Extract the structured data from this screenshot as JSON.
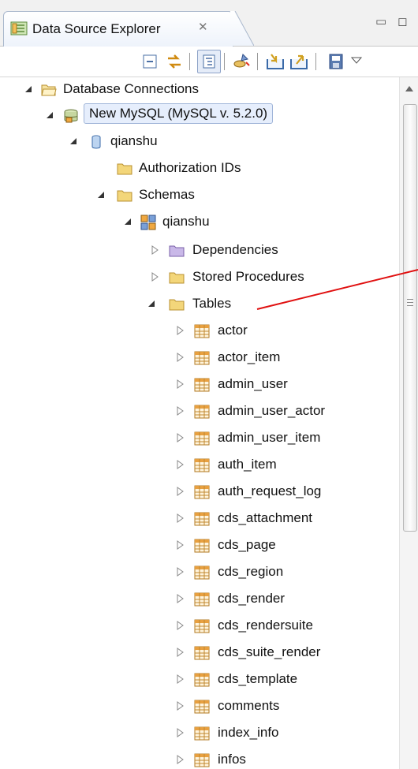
{
  "window": {
    "tab_title": "Data Source Explorer",
    "tab_close_glyph": "✕",
    "minimize_glyph": "▭",
    "maximize_glyph": "◻"
  },
  "toolbar": {
    "buttons": [
      {
        "name": "collapse-all-icon"
      },
      {
        "name": "link-with-editor-icon"
      },
      {
        "name": "show-tree-icon"
      },
      {
        "name": "new-connection-profile-icon"
      },
      {
        "name": "import-icon"
      },
      {
        "name": "export-icon"
      },
      {
        "name": "save-icon"
      },
      {
        "name": "view-menu-icon"
      }
    ]
  },
  "tree": {
    "root": "Database Connections",
    "connection": "New MySQL (MySQL v. 5.2.0)",
    "database": "qianshu",
    "authorization": "Authorization IDs",
    "schemas": "Schemas",
    "schema": "qianshu",
    "dependencies": "Dependencies",
    "stored_procedures": "Stored Procedures",
    "tables_folder": "Tables",
    "tables": [
      "actor",
      "actor_item",
      "admin_user",
      "admin_user_actor",
      "admin_user_item",
      "auth_item",
      "auth_request_log",
      "cds_attachment",
      "cds_page",
      "cds_region",
      "cds_render",
      "cds_rendersuite",
      "cds_suite_render",
      "cds_template",
      "comments",
      "index_info",
      "infos"
    ]
  },
  "colors": {
    "annotation_line": "#e01010",
    "folder_yellow": "#f3d67a",
    "folder_purple": "#c9b8e8",
    "table_orange": "#e8a040",
    "selection_bg": "#e6eefc"
  }
}
